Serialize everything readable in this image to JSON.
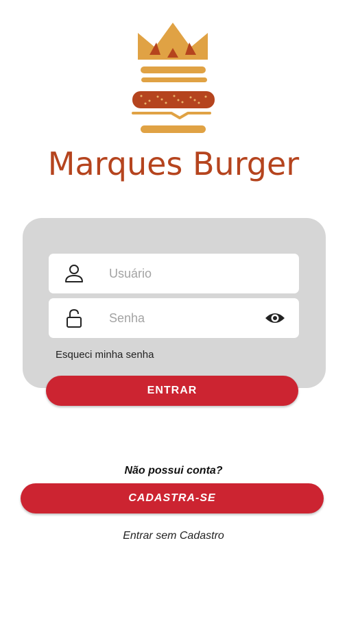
{
  "brand": {
    "name": "Marques Burger",
    "colors": {
      "primary": "#cc2431",
      "brand_text": "#b5441e",
      "bun": "#e0a244",
      "patty": "#b5441e",
      "card_bg": "#d6d6d6"
    }
  },
  "login": {
    "username": {
      "placeholder": "Usuário",
      "icon": "user-icon"
    },
    "password": {
      "placeholder": "Senha",
      "icon": "lock-icon",
      "toggle_icon": "eye-icon"
    },
    "forgot_label": "Esqueci minha senha",
    "enter_label": "ENTRAR"
  },
  "signup": {
    "prompt": "Não possui conta?",
    "button_label": "CADASTRA-SE",
    "guest_label": "Entrar sem Cadastro"
  }
}
